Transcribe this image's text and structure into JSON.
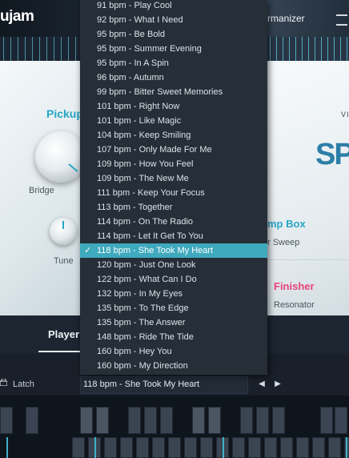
{
  "app": {
    "brand": "ujam",
    "header_right": "rmanizer"
  },
  "left_panel": {
    "pickup_title": "Pickup",
    "bridge_label": "Bridge",
    "tune_label": "Tune"
  },
  "right_panel": {
    "vi_text": "VI",
    "logo_text": "SP",
    "ampbox_title": "mp Box",
    "filter_sweep": "r Sweep",
    "finisher_title": "Finisher",
    "resonator": "Resonator"
  },
  "tabs": {
    "player_label": "Player"
  },
  "bottom_bar": {
    "latch_label": "Latch",
    "pattern_value": "118 bpm - She Took My Heart",
    "prev_icon": "◀",
    "next_icon": "▶"
  },
  "dropdown": {
    "selected_index": 17,
    "items": [
      "91 bpm - Play Cool",
      "92 bpm - What I Need",
      "95 bpm - Be Bold",
      "95 bpm - Summer Evening",
      "95 bpm - In A Spin",
      "96 bpm - Autumn",
      "99 bpm - Bitter Sweet Memories",
      "101 bpm - Right Now",
      "101 bpm - Like Magic",
      "104 bpm - Keep Smiling",
      "107 bpm - Only Made For Me",
      "109 bpm - How You Feel",
      "109 bpm - The New Me",
      "111 bpm - Keep Your Focus",
      "113 bpm - Together",
      "114 bpm - On The Radio",
      "114 bpm - Let It Get To You",
      "118 bpm - She Took My Heart",
      "120 bpm - Just One Look",
      "122 bpm - What Can I Do",
      "132 bpm - In My Eyes",
      "135 bpm - To The Edge",
      "135 bpm - The Answer",
      "148 bpm - Ride The Tide",
      "160 bpm - Hey You",
      "160 bpm - My Direction"
    ]
  },
  "colors": {
    "accent": "#3fa9bd",
    "finisher": "#e9447a"
  }
}
